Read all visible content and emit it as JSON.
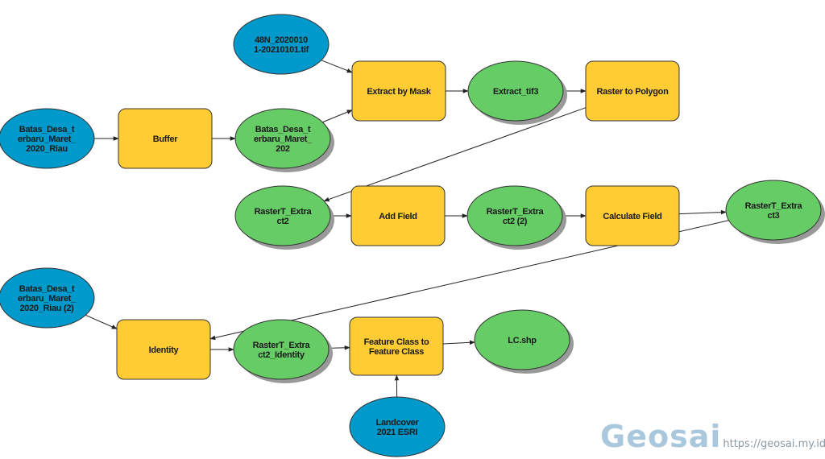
{
  "diagram": {
    "type": "model-builder-flow",
    "colors": {
      "input_data": "#0099cc",
      "tool": "#ffcc33",
      "derived_data": "#66cc66",
      "outline": "#333333",
      "shadow": "#999999",
      "connector": "#222222"
    },
    "nodes": [
      {
        "id": "n_raster_in",
        "kind": "input_data",
        "lines": [
          "48N_2020010",
          "1-20210101.tif"
        ]
      },
      {
        "id": "n_batas_in",
        "kind": "input_data",
        "lines": [
          "Batas_Desa_t",
          "erbaru_Maret_",
          "2020_Riau"
        ]
      },
      {
        "id": "n_buffer",
        "kind": "tool",
        "lines": [
          "Buffer"
        ]
      },
      {
        "id": "n_batas_buf",
        "kind": "derived_data",
        "lines": [
          "Batas_Desa_t",
          "erbaru_Maret_",
          "202"
        ]
      },
      {
        "id": "n_extract_mask",
        "kind": "tool",
        "lines": [
          "Extract by Mask"
        ]
      },
      {
        "id": "n_extract_tif3",
        "kind": "derived_data",
        "lines": [
          "Extract_tif3"
        ]
      },
      {
        "id": "n_raster_poly",
        "kind": "tool",
        "lines": [
          "Raster to Polygon"
        ]
      },
      {
        "id": "n_rastert2",
        "kind": "derived_data",
        "lines": [
          "RasterT_Extra",
          "ct2"
        ]
      },
      {
        "id": "n_add_field",
        "kind": "tool",
        "lines": [
          "Add Field"
        ]
      },
      {
        "id": "n_rastert2_2",
        "kind": "derived_data",
        "lines": [
          "RasterT_Extra",
          "ct2 (2)"
        ]
      },
      {
        "id": "n_calc_field",
        "kind": "tool",
        "lines": [
          "Calculate Field"
        ]
      },
      {
        "id": "n_rastert3",
        "kind": "derived_data",
        "lines": [
          "RasterT_Extra",
          "ct3"
        ]
      },
      {
        "id": "n_batas_in2",
        "kind": "input_data",
        "lines": [
          "Batas_Desa_t",
          "erbaru_Maret_",
          "2020_Riau (2)"
        ]
      },
      {
        "id": "n_identity",
        "kind": "tool",
        "lines": [
          "Identity"
        ]
      },
      {
        "id": "n_rastert2_id",
        "kind": "derived_data",
        "lines": [
          "RasterT_Extra",
          "ct2_Identity"
        ]
      },
      {
        "id": "n_fc2fc",
        "kind": "tool",
        "lines": [
          "Feature Class to",
          "Feature Class"
        ]
      },
      {
        "id": "n_lc",
        "kind": "derived_data",
        "lines": [
          "LC.shp"
        ]
      },
      {
        "id": "n_landcover",
        "kind": "input_data",
        "lines": [
          "Landcover",
          "2021 ESRI"
        ]
      }
    ],
    "edges": [
      {
        "from": "n_batas_in",
        "to": "n_buffer"
      },
      {
        "from": "n_buffer",
        "to": "n_batas_buf"
      },
      {
        "from": "n_raster_in",
        "to": "n_extract_mask"
      },
      {
        "from": "n_batas_buf",
        "to": "n_extract_mask"
      },
      {
        "from": "n_extract_mask",
        "to": "n_extract_tif3"
      },
      {
        "from": "n_extract_tif3",
        "to": "n_raster_poly"
      },
      {
        "from": "n_raster_poly",
        "to": "n_rastert2"
      },
      {
        "from": "n_rastert2",
        "to": "n_add_field"
      },
      {
        "from": "n_add_field",
        "to": "n_rastert2_2"
      },
      {
        "from": "n_rastert2_2",
        "to": "n_calc_field"
      },
      {
        "from": "n_calc_field",
        "to": "n_rastert3"
      },
      {
        "from": "n_rastert3",
        "to": "n_identity"
      },
      {
        "from": "n_batas_in2",
        "to": "n_identity"
      },
      {
        "from": "n_identity",
        "to": "n_rastert2_id"
      },
      {
        "from": "n_rastert2_id",
        "to": "n_fc2fc"
      },
      {
        "from": "n_fc2fc",
        "to": "n_lc"
      },
      {
        "from": "n_landcover",
        "to": "n_fc2fc"
      }
    ]
  },
  "watermark": {
    "brand": "Geosai",
    "url": "https://geosai.my.id"
  }
}
